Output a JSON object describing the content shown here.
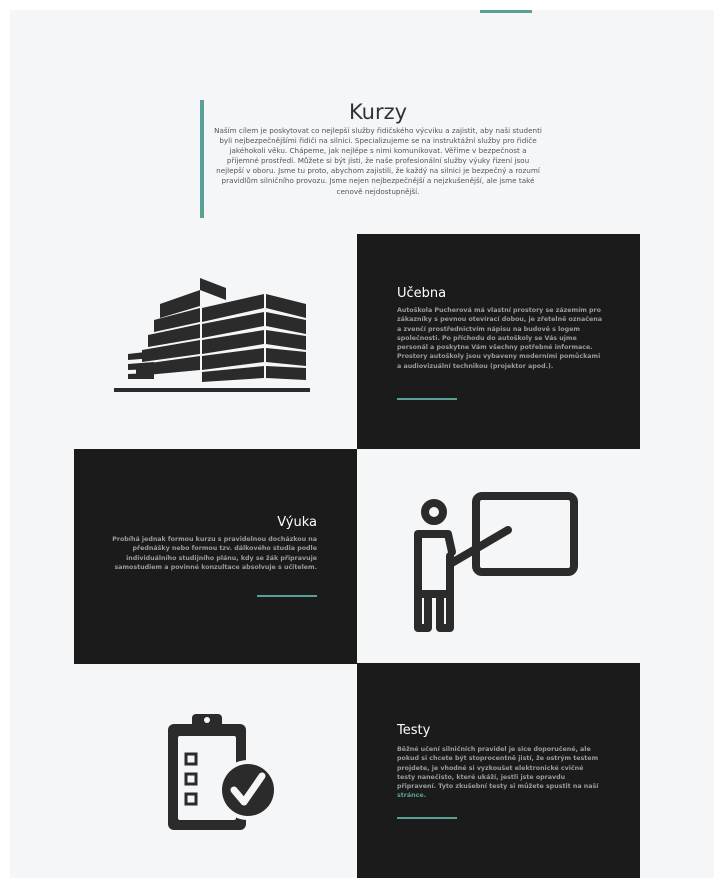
{
  "intro": {
    "title": "Kurzy",
    "text": "Naším cílem je poskytovat co nejlepší služby řidičského výcviku a zajistit, aby naši studenti byli nejbezpečnějšími řidiči na silnici. Specializujeme se na instruktážní služby pro řidiče jakéhokoli věku. Chápeme, jak nejlépe s nimi komunikovat. Věříme v bezpečnost a příjemné prostředí. Můžete si být jisti, že naše profesionální služby výuky řízení jsou nejlepší v oboru. Jsme tu proto, abychom zajistili, že každý na silnici je bezpečný a rozumí pravidlům silničního provozu. Jsme nejen nejbezpečnější a nejzkušenější, ale jsme také cenově nejdostupnější."
  },
  "sections": {
    "ucebna": {
      "title": "Učebna",
      "text": "Autoškola Pucherová má vlastní prostory se zázemím pro zákazníky s pevnou otevírací dobou, je zřetelně označena a zvenčí prostřednictvím nápisu na budově s logem společnosti. Po příchodu do autoškoly se Vás ujme personál a poskytne Vám všechny potřebné informace. Prostory autoškoly jsou vybaveny moderními pomůckami a audiovizuální technikou (projektor apod.).",
      "icon": "building-icon"
    },
    "vyuka": {
      "title": "Výuka",
      "text": "Probíhá jednak formou kurzu s pravidelnou docházkou na přednášky nebo formou tzv. dálkového studia podle individuálního studijního plánu, kdy se žák připravuje samostudiem a povinné konzultace absolvuje s učitelem.",
      "icon": "teacher-board-icon"
    },
    "testy": {
      "title": "Testy",
      "text": "Běžné učení silničních pravidel je sice doporučené, ale pokud si chcete být stoprocentně jistí, že ostrým testem projdete, je vhodné si vyzkoušet elektronické cvičné testy nanečisto, které ukáží, jestli jste opravdu připravení. Tyto zkušební testy si můžete spustit na naší",
      "link": "stránce.",
      "icon": "clipboard-check-icon"
    }
  },
  "colors": {
    "accent": "#5aa096",
    "panel": "#1b1b1b",
    "background": "#f5f6f8"
  }
}
